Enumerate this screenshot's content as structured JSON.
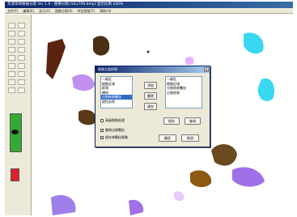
{
  "window": {
    "title": "荒漠草原植被分类 Ver 1.0 - 图像分割 [SS1709.bmp] 显示比例 100%"
  },
  "menu": [
    "文件(F)",
    "编辑(E)",
    "显示(V)",
    "图像分割(S)",
    "特征提取(T)",
    "帮助(H)"
  ],
  "dialog": {
    "title": "图像分类样例",
    "close_glyph": "✕",
    "left_list": [
      "一级区",
      "植株区域",
      "群落",
      "裸地",
      "分割结果叠加",
      "遮挡去除"
    ],
    "left_selected_index": 4,
    "right_list": [
      "一级区",
      "植株区域",
      "分割结果叠加",
      "分割结果"
    ],
    "buttons": {
      "add": "添加",
      "delete": "删除",
      "clear": "清空",
      "save": "保存",
      "query": "查询",
      "confirm": "确定",
      "cancel": "取消"
    },
    "checkboxes": [
      {
        "label": "高级图像处理",
        "checked": false
      },
      {
        "label": "删除边缘颗粒",
        "checked": true
      },
      {
        "label": "保存单颗粒图像",
        "checked": true
      }
    ]
  }
}
